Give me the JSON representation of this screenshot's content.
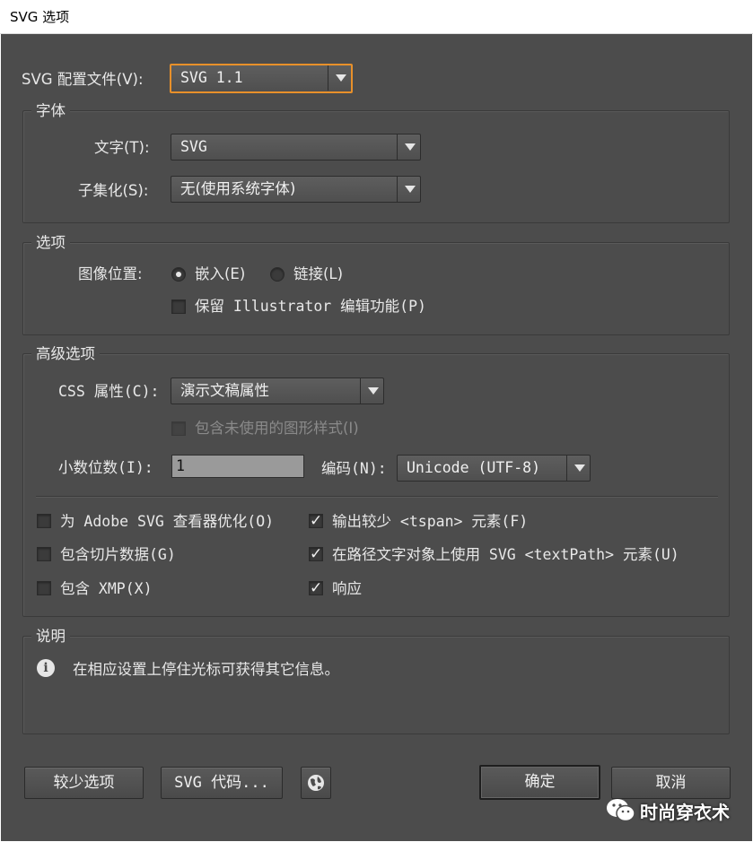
{
  "window": {
    "title": "SVG 选项"
  },
  "profile": {
    "label": "SVG 配置文件(V):",
    "value": "SVG 1.1"
  },
  "fonts": {
    "title": "字体",
    "text_label": "文字(T):",
    "text_value": "SVG",
    "subset_label": "子集化(S):",
    "subset_value": "无(使用系统字体)"
  },
  "options": {
    "title": "选项",
    "image_location_label": "图像位置:",
    "embed_label": "嵌入(E)",
    "link_label": "链接(L)",
    "preserve_label": "保留 Illustrator 编辑功能(P)"
  },
  "advanced": {
    "title": "高级选项",
    "css_label": "CSS 属性(C):",
    "css_value": "演示文稿属性",
    "include_unused_label": "包含未使用的图形样式(I)",
    "decimal_label": "小数位数(I):",
    "decimal_value": "1",
    "encoding_label": "编码(N):",
    "encoding_value": "Unicode (UTF-8)",
    "opt_adobe_viewer": "为 Adobe SVG 查看器优化(O)",
    "opt_slice_data": "包含切片数据(G)",
    "opt_xmp": "包含 XMP(X)",
    "opt_less_tspan": "输出较少 <tspan> 元素(F)",
    "opt_textpath": "在路径文字对象上使用 SVG <textPath> 元素(U)",
    "opt_responsive": "响应",
    "check_mark": "✓"
  },
  "description": {
    "title": "说明",
    "info_glyph": "i",
    "text": "在相应设置上停住光标可获得其它信息。"
  },
  "buttons": {
    "fewer_options": "较少选项",
    "svg_code": "SVG 代码...",
    "ok": "确定",
    "cancel": "取消"
  },
  "watermark": {
    "text": "时尚穿衣术"
  },
  "colors": {
    "dialog_bg": "#4c4c4c",
    "focus_ring": "#e8902a"
  }
}
